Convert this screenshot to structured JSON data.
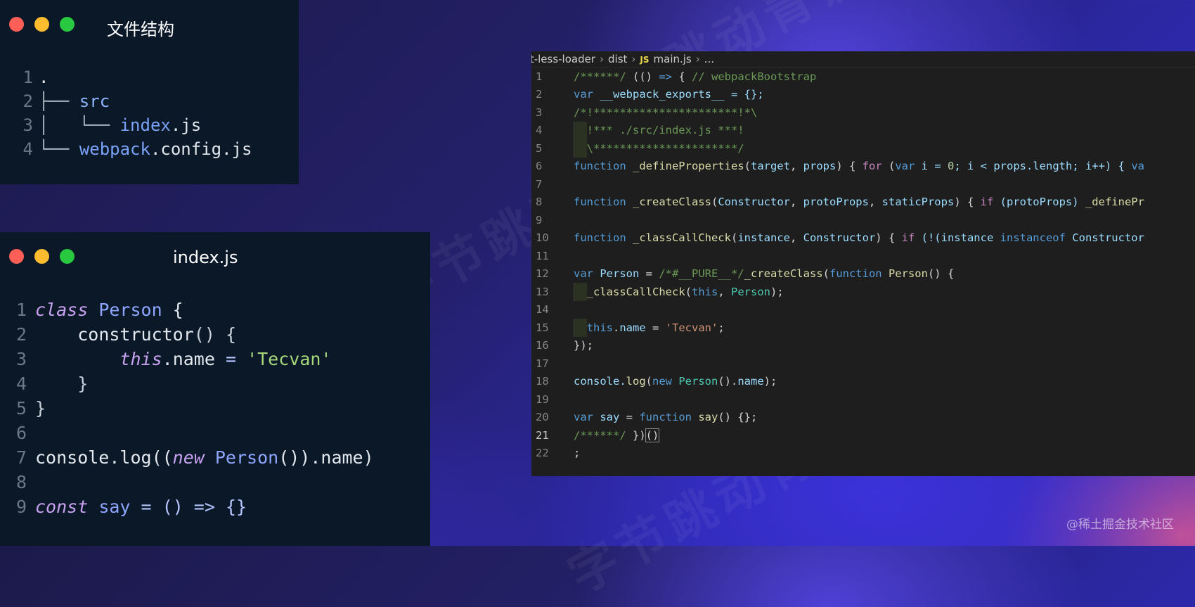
{
  "file_window": {
    "title": "文件结构",
    "lines": [
      {
        "num": "1",
        "prefix": "",
        "dir": "",
        "name": ".",
        "ext": ""
      },
      {
        "num": "2",
        "prefix": "├── ",
        "dir": "src",
        "name": "",
        "ext": ""
      },
      {
        "num": "3",
        "prefix": "│   └── ",
        "dir": "",
        "name": "index",
        "ext": ".js"
      },
      {
        "num": "4",
        "prefix": "└── ",
        "dir": "",
        "name": "webpack",
        "ext": ".config.js"
      }
    ]
  },
  "index_window": {
    "title": "index.js",
    "line_numbers": [
      "1",
      "2",
      "3",
      "4",
      "5",
      "6",
      "7",
      "8",
      "9"
    ],
    "code": {
      "l1_kw": "class",
      "l1_cls": " Person",
      "l1_rest": " {",
      "l2_indent": "    ",
      "l2_fn": "constructor",
      "l2_rest": "() {",
      "l3_indent": "        ",
      "l3_this": "this",
      "l3_prop": ".name",
      "l3_eq": " = ",
      "l3_str": "'Tecvan'",
      "l4": "    }",
      "l5": "}",
      "l6": "",
      "l7_a": "console.log((",
      "l7_new": "new",
      "l7_cls": " Person",
      "l7_b": "()).name)",
      "l8": "",
      "l9_kw": "const",
      "l9_name": " say",
      "l9_rest": " = () => {}"
    }
  },
  "vscode_window": {
    "breadcrumb": {
      "folder": "st-less-loader",
      "subfolder": "dist",
      "file_badge": "JS",
      "file": "main.js",
      "more": "..."
    },
    "line_numbers": [
      "1",
      "2",
      "3",
      "4",
      "5",
      "6",
      "7",
      "8",
      "9",
      "10",
      "11",
      "12",
      "13",
      "14",
      "15",
      "16",
      "17",
      "18",
      "19",
      "20",
      "21",
      "22"
    ],
    "active_line": "21",
    "code": {
      "l1_cm": "/******/",
      "l1_a": " (() ",
      "l1_arrow": "=>",
      "l1_b": " { ",
      "l1_cm2": "// webpackBootstrap",
      "l2_var": "var",
      "l2_a": " __webpack_exports__ = {};",
      "l3_cm": "/*!**********************!*\\",
      "l4_cm": "  !*** ./src/index.js ***!",
      "l5_cm": "  \\**********************/",
      "l6_fn": "function",
      "l6_name": " _defineProperties",
      "l6_a": "(",
      "l6_p1": "target",
      "l6_b": ", ",
      "l6_p2": "props",
      "l6_c": ") { ",
      "l6_for": "for",
      "l6_d": " (",
      "l6_var": "var",
      "l6_e": " i = ",
      "l6_zero": "0",
      "l6_f": "; i < props.length; i++) { ",
      "l6_va": "va",
      "l8_fn": "function",
      "l8_name": " _createClass",
      "l8_a": "(",
      "l8_p1": "Constructor",
      "l8_b": ", ",
      "l8_p2": "protoProps",
      "l8_c": ", ",
      "l8_p3": "staticProps",
      "l8_d": ") { ",
      "l8_if": "if",
      "l8_e": " (protoProps) ",
      "l8_call": "_definePr",
      "l10_fn": "function",
      "l10_name": " _classCallCheck",
      "l10_a": "(",
      "l10_p1": "instance",
      "l10_b": ", ",
      "l10_p2": "Constructor",
      "l10_c": ") { ",
      "l10_if": "if",
      "l10_d": " (!(instance ",
      "l10_inst": "instanceof",
      "l10_e": " Constructor",
      "l12_var": "var",
      "l12_name": " Person",
      "l12_a": " = ",
      "l12_cm": "/*#__PURE__*/",
      "l12_call": "_createClass",
      "l12_b": "(",
      "l12_fn": "function",
      "l12_fname": " Person",
      "l12_c": "() {",
      "l13_call": "_classCallCheck",
      "l13_a": "(",
      "l13_this": "this",
      "l13_b": ", ",
      "l13_cls": "Person",
      "l13_c": ");",
      "l15_this": "this",
      "l15_a": ".",
      "l15_prop": "name",
      "l15_b": " = ",
      "l15_str": "'Tecvan'",
      "l15_c": ";",
      "l16": "});",
      "l18_a": "console.",
      "l18_log": "log",
      "l18_b": "(",
      "l18_new": "new",
      "l18_cls": " Person",
      "l18_c": "().",
      "l18_prop": "name",
      "l18_d": ");",
      "l20_var": "var",
      "l20_name": " say",
      "l20_a": " = ",
      "l20_fn": "function",
      "l20_fname": " say",
      "l20_b": "() {};",
      "l21_cm": "/******/",
      "l21_a": " })",
      "l21_paren": "()",
      "l22": ";"
    }
  },
  "watermark_text": "字节跳动青训营",
  "footer_credit": "@稀土掘金技术社区"
}
